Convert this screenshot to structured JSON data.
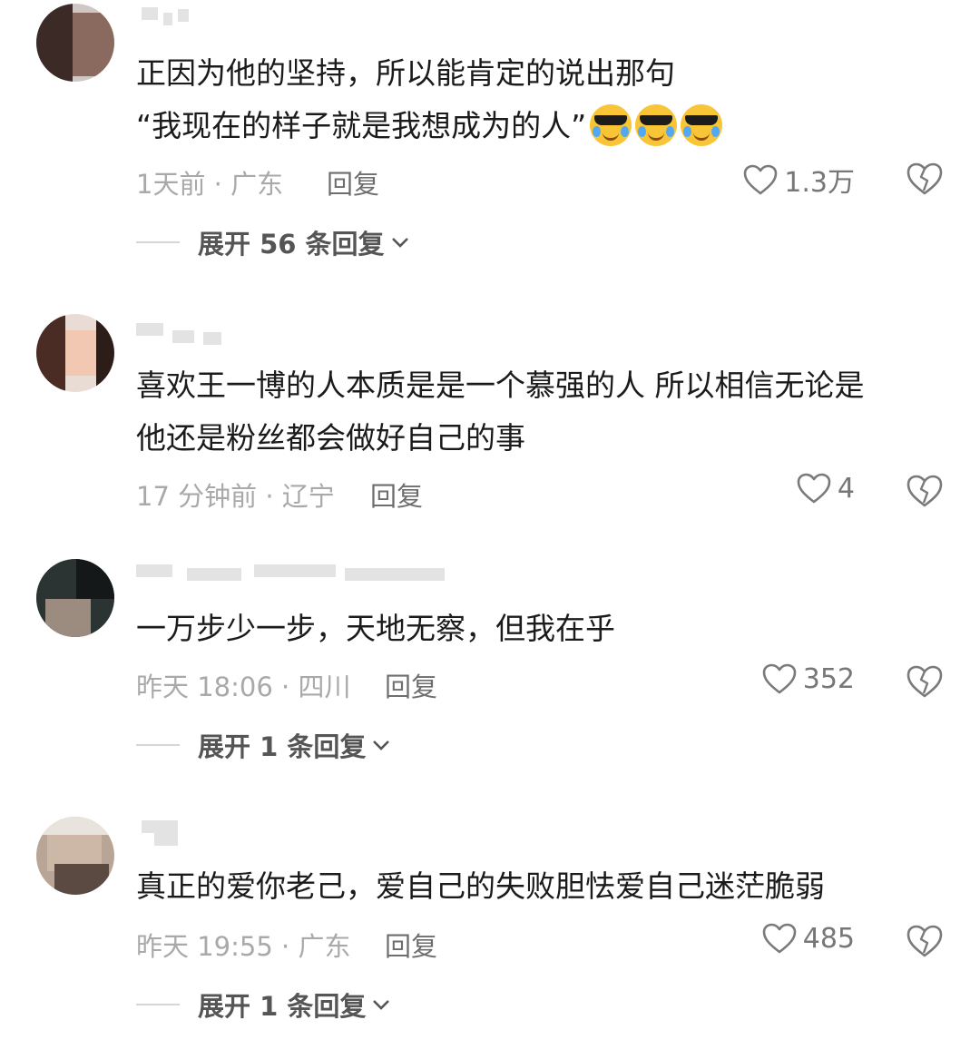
{
  "comments": [
    {
      "text_lines": [
        "正因为他的坚持，所以能肯定的说出那句",
        "“我现在的样子就是我想成为的人”"
      ],
      "emoji_count": 3,
      "emoji_name": "cool-crying-emoji",
      "time_location": "1天前 · 广东",
      "reply_label": "回复",
      "likes": "1.3万",
      "expand_label": "展开 56 条回复"
    },
    {
      "text_lines": [
        "喜欢王一博的人本质是是一个慕强的人 所以相信无论是",
        "他还是粉丝都会做好自己的事"
      ],
      "time_location": "17 分钟前 · 辽宁",
      "reply_label": "回复",
      "likes": "4"
    },
    {
      "text_lines": [
        "一万步少一步，天地无察，但我在乎"
      ],
      "time_location": "昨天 18:06 · 四川",
      "reply_label": "回复",
      "likes": "352",
      "expand_label": "展开 1 条回复"
    },
    {
      "text_lines": [
        "真正的爱你老己，爱自己的失败胆怯爱自己迷茫脆弱"
      ],
      "time_location": "昨天 19:55 · 广东",
      "reply_label": "回复",
      "likes": "485",
      "expand_label": "展开 1 条回复"
    }
  ],
  "icons": {
    "like": "heart-outline-icon",
    "dislike": "broken-heart-icon",
    "expand": "chevron-down-icon"
  },
  "colors": {
    "text": "#1b1b1b",
    "meta": "#a9a9a9",
    "reply": "#6e6e6e",
    "icon": "#7a7a7a"
  }
}
